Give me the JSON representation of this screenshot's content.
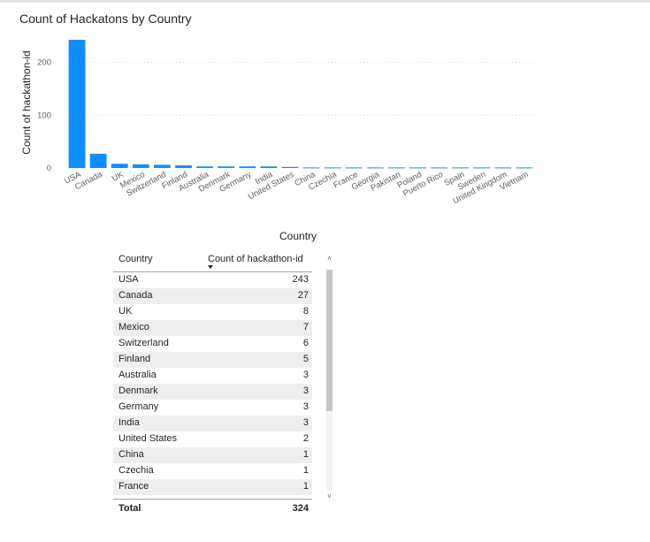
{
  "chart_data": {
    "type": "bar",
    "title": "Count of Hackatons by Country",
    "xlabel": "",
    "ylabel": "Count of hackathon-id",
    "categories": [
      "USA",
      "Canada",
      "UK",
      "Mexico",
      "Switzerland",
      "Finland",
      "Australia",
      "Denmark",
      "Germany",
      "India",
      "United States",
      "China",
      "Czechia",
      "France",
      "Georgia",
      "Pakistan",
      "Poland",
      "Puerto Rico",
      "Spain",
      "Sweden",
      "United Kingdom",
      "Vietnam"
    ],
    "values": [
      243,
      27,
      8,
      7,
      6,
      5,
      3,
      3,
      3,
      3,
      2,
      1,
      1,
      1,
      1,
      1,
      1,
      1,
      1,
      1,
      1,
      1
    ],
    "ylim": [
      0,
      243
    ],
    "yticks": [
      "0",
      "100",
      "200"
    ],
    "grid": true,
    "bar_color": "#118DFF"
  },
  "table": {
    "title": "Country",
    "columns": [
      "Country",
      "Count of hackathon-id"
    ],
    "rows": [
      [
        "USA",
        "243"
      ],
      [
        "Canada",
        "27"
      ],
      [
        "UK",
        "8"
      ],
      [
        "Mexico",
        "7"
      ],
      [
        "Switzerland",
        "6"
      ],
      [
        "Finland",
        "5"
      ],
      [
        "Australia",
        "3"
      ],
      [
        "Denmark",
        "3"
      ],
      [
        "Germany",
        "3"
      ],
      [
        "India",
        "3"
      ],
      [
        "United States",
        "2"
      ],
      [
        "China",
        "1"
      ],
      [
        "Czechia",
        "1"
      ],
      [
        "France",
        "1"
      ]
    ],
    "total_label": "Total",
    "total_value": "324"
  },
  "scrollbar": {
    "up_icon": "chevron-up-icon",
    "down_icon": "chevron-down-icon"
  }
}
